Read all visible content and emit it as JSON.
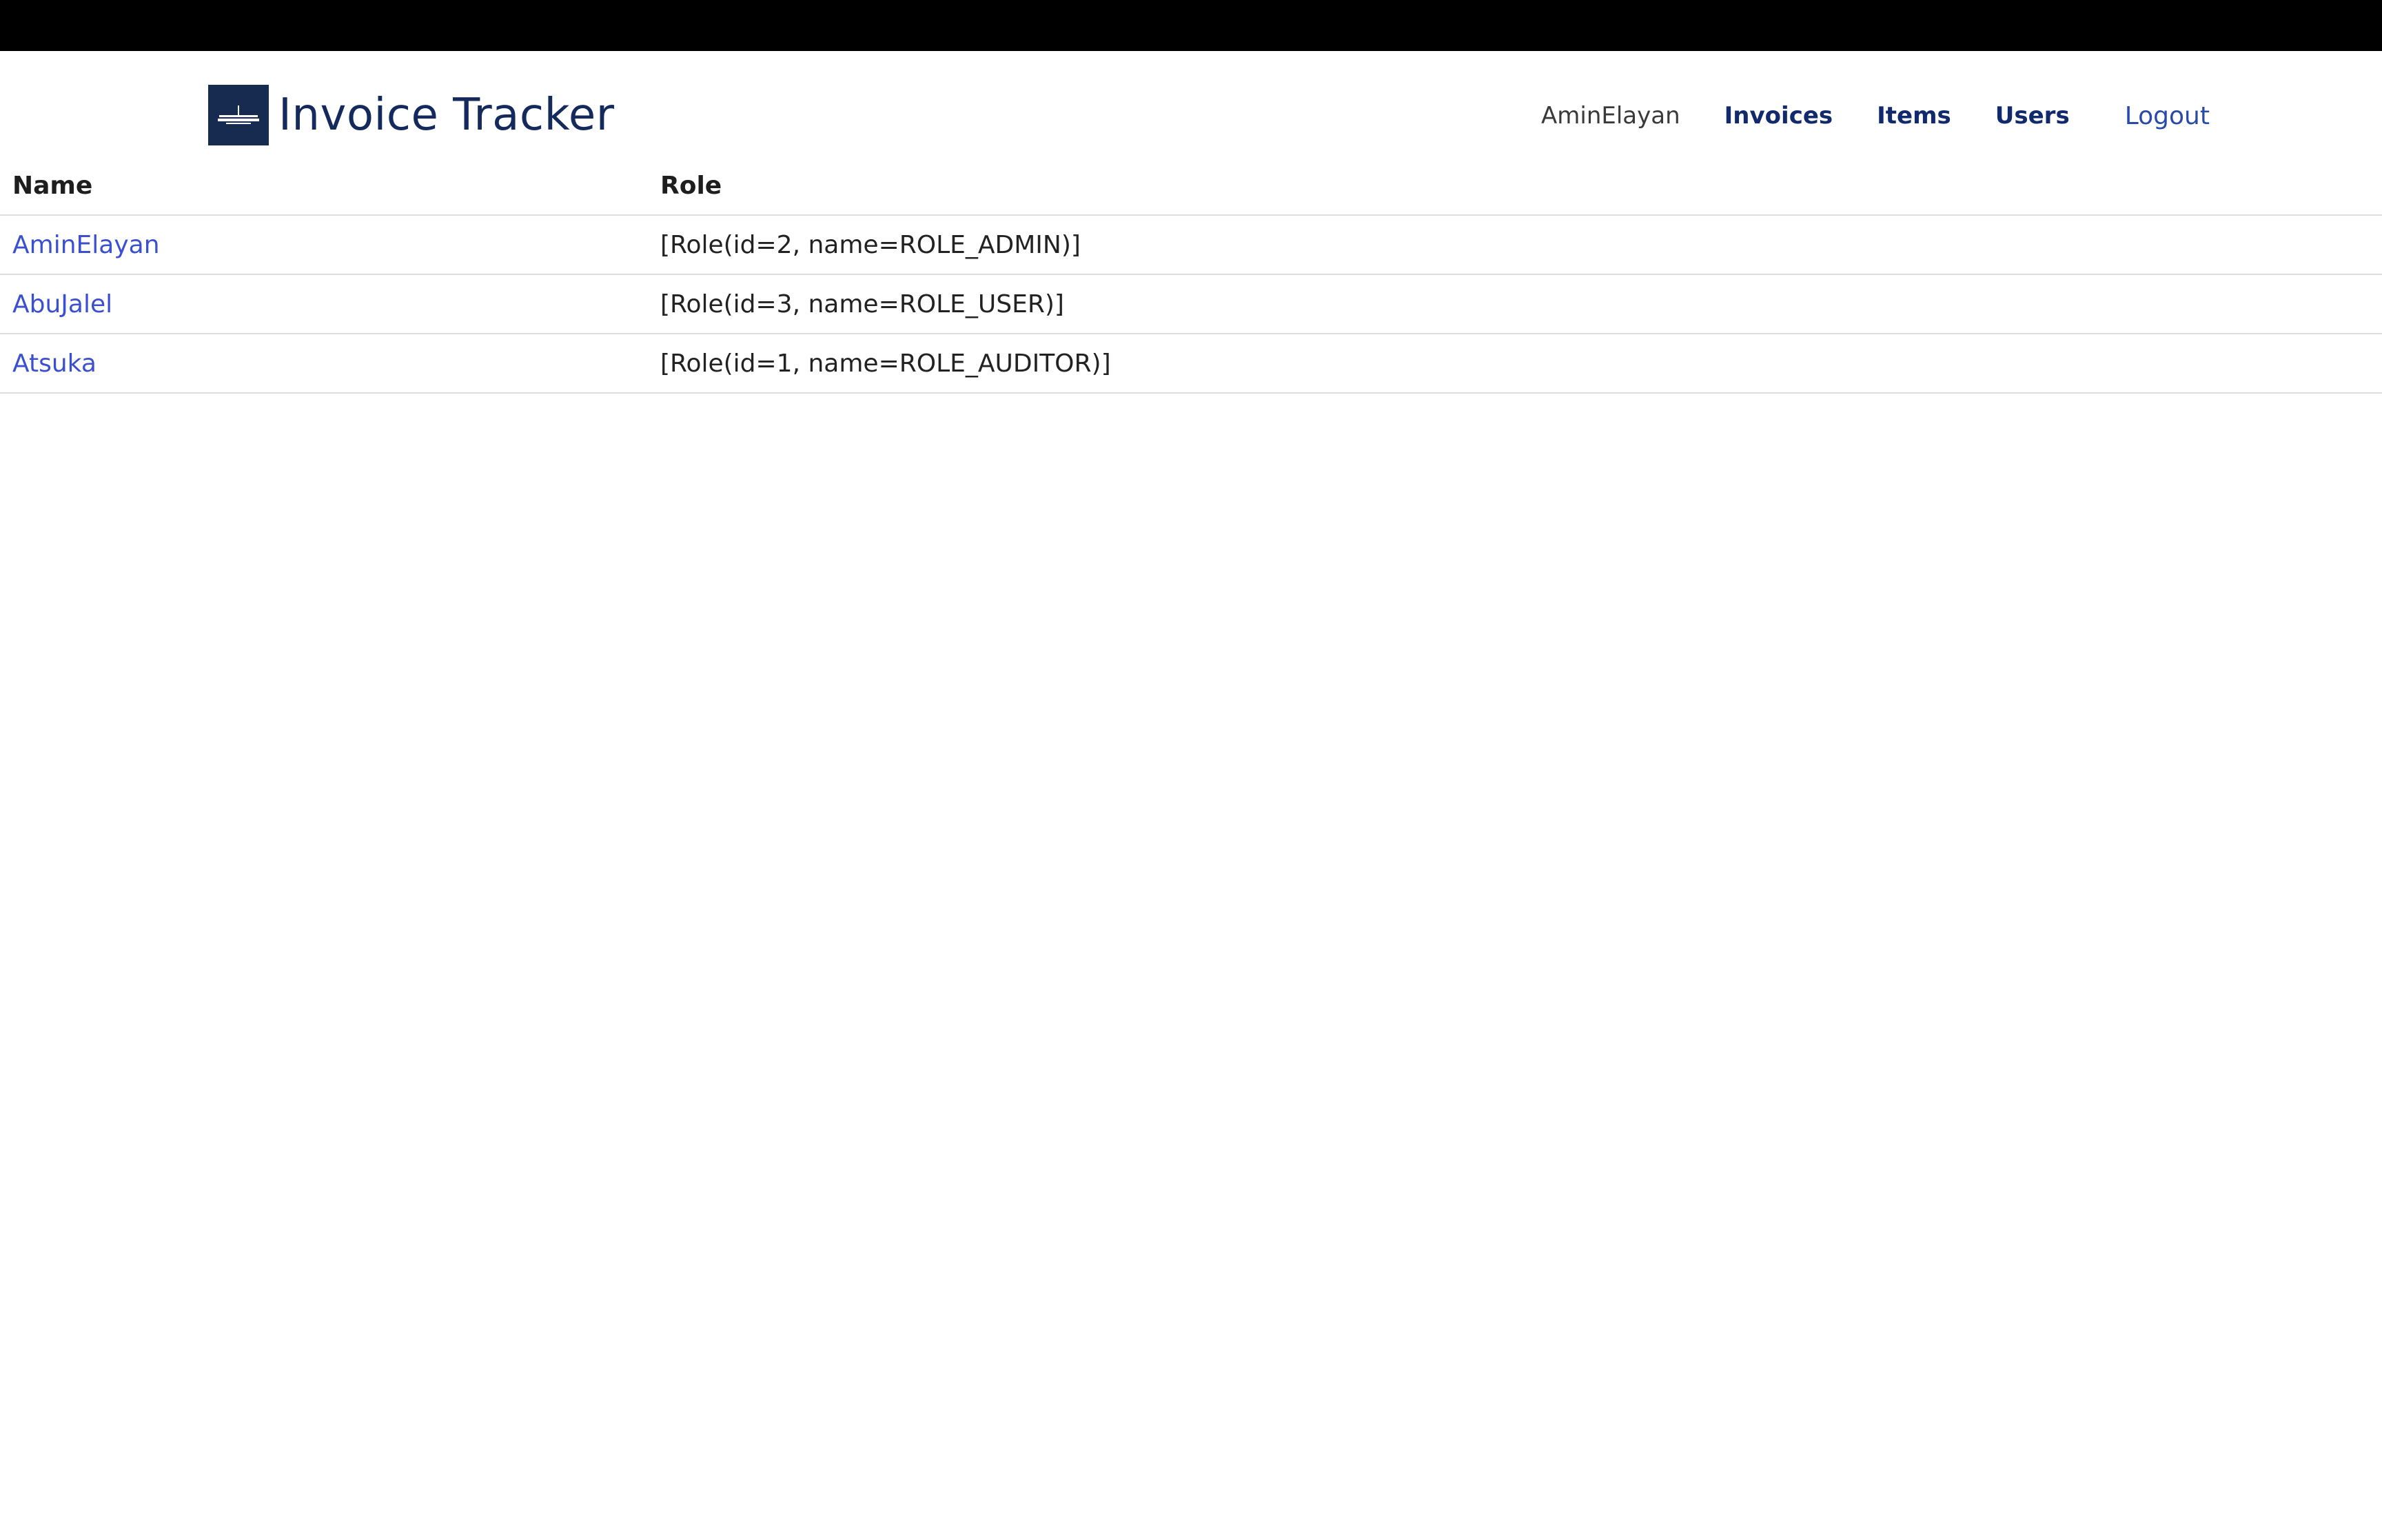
{
  "app": {
    "title": "Invoice Tracker"
  },
  "nav": {
    "current_user": "AminElayan",
    "links": [
      {
        "label": "Invoices"
      },
      {
        "label": "Items"
      },
      {
        "label": "Users"
      }
    ],
    "logout_label": "Logout"
  },
  "table": {
    "headers": {
      "name": "Name",
      "role": "Role"
    },
    "rows": [
      {
        "name": "AminElayan",
        "role": "[Role(id=2, name=ROLE_ADMIN)]"
      },
      {
        "name": "AbuJalel",
        "role": "[Role(id=3, name=ROLE_USER)]"
      },
      {
        "name": "Atsuka",
        "role": "[Role(id=1, name=ROLE_AUDITOR)]"
      }
    ]
  },
  "colors": {
    "top_bar": "#000000",
    "brand": "#142a5c",
    "nav_link": "#102a6b",
    "user_link": "#3b4fd1",
    "row_border": "#dedede"
  },
  "icons": {
    "logo": "invoice-tracker-logo-icon"
  }
}
